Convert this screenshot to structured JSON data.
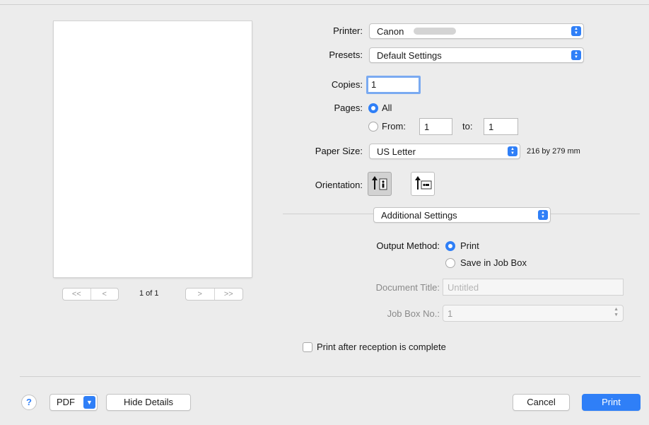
{
  "preview": {
    "page_indicator": "1 of 1",
    "nav_first": "<<",
    "nav_prev": "<",
    "nav_next": ">",
    "nav_last": ">>"
  },
  "printer": {
    "label": "Printer:",
    "value": "Canon"
  },
  "presets": {
    "label": "Presets:",
    "value": "Default Settings"
  },
  "copies": {
    "label": "Copies:",
    "value": "1"
  },
  "pages": {
    "label": "Pages:",
    "all_label": "All",
    "from_label": "From:",
    "from_value": "1",
    "to_label": "to:",
    "to_value": "1",
    "selected": "All"
  },
  "paper_size": {
    "label": "Paper Size:",
    "value": "US Letter",
    "dimensions": "216 by 279 mm"
  },
  "orientation": {
    "label": "Orientation:",
    "selected": "portrait",
    "icons": [
      "portrait-orientation-icon",
      "landscape-orientation-icon"
    ]
  },
  "section": {
    "value": "Additional Settings"
  },
  "output_method": {
    "label": "Output Method:",
    "option_print": "Print",
    "option_job_box": "Save in Job Box",
    "selected": "Print"
  },
  "document_title": {
    "label": "Document Title:",
    "placeholder": "Untitled"
  },
  "job_box": {
    "label": "Job Box No.:",
    "value": "1"
  },
  "print_after": {
    "label": "Print after reception is complete",
    "checked": false
  },
  "footer": {
    "help": "?",
    "pdf": "PDF",
    "hide_details": "Hide Details",
    "cancel": "Cancel",
    "print": "Print"
  },
  "colors": {
    "accent": "#2f7ff7",
    "background": "#ececec",
    "focus_ring": "#7aaaf1"
  }
}
